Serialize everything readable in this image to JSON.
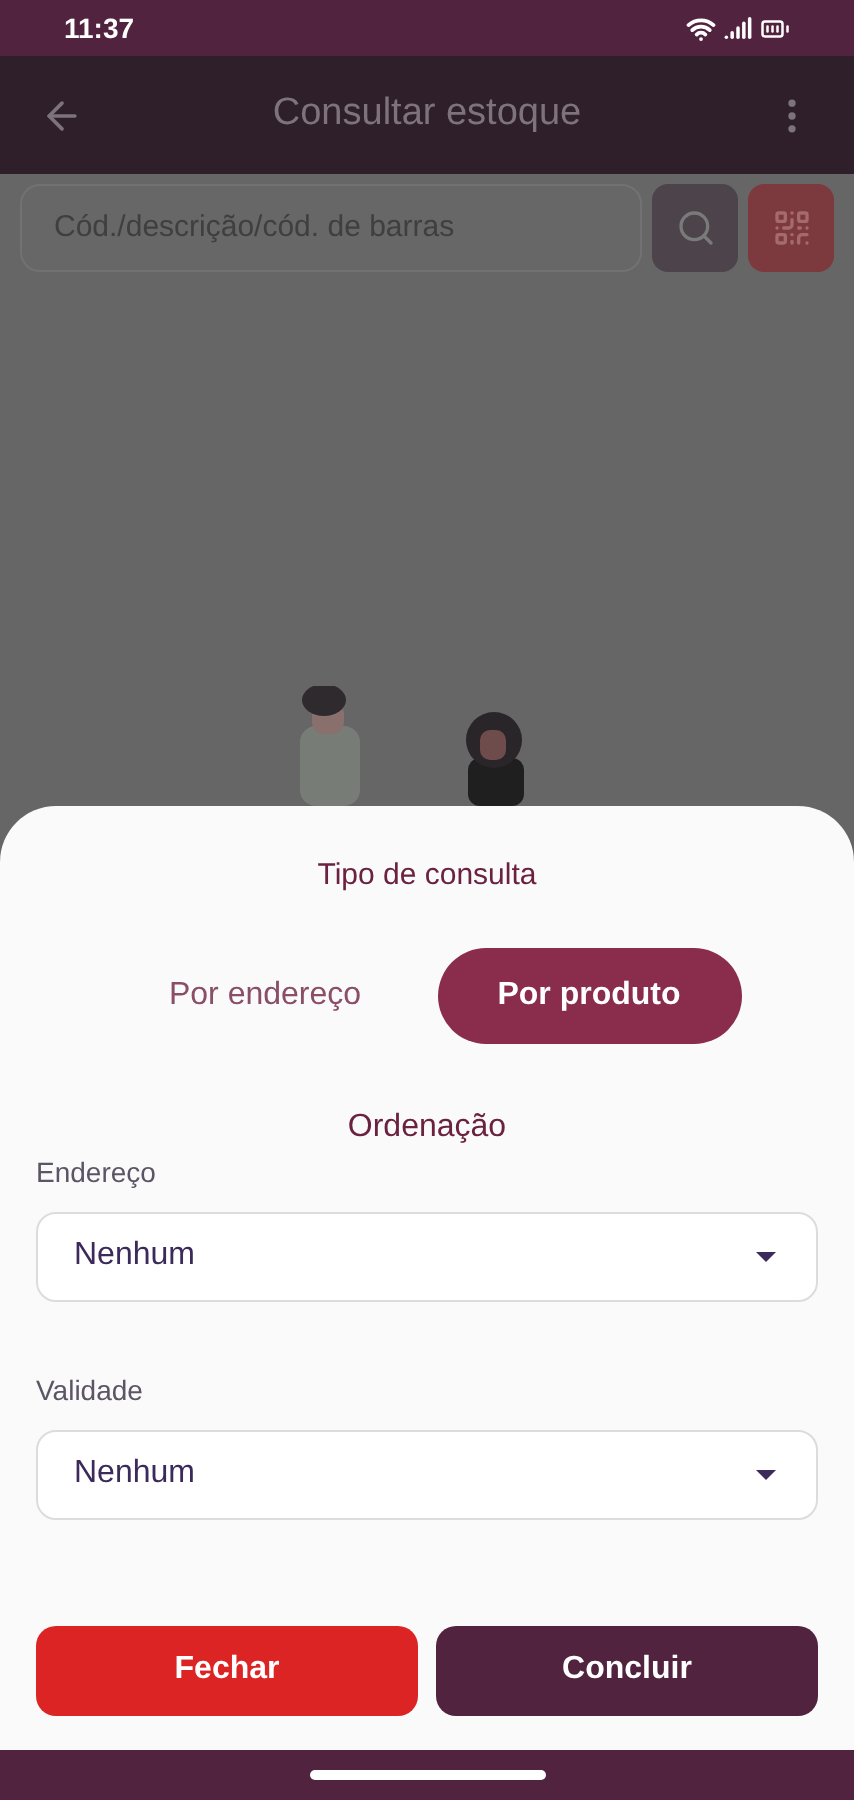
{
  "status_bar": {
    "time": "11:37"
  },
  "app_bar": {
    "title": "Consultar estoque"
  },
  "search": {
    "placeholder": "Cód./descrição/cód. de barras"
  },
  "sheet": {
    "title": "Tipo de consulta",
    "options": [
      {
        "label": "Por endereço",
        "selected": false
      },
      {
        "label": "Por produto",
        "selected": true
      }
    ],
    "section_title": "Ordenação",
    "fields": [
      {
        "label": "Endereço",
        "value": "Nenhum"
      },
      {
        "label": "Validade",
        "value": "Nenhum"
      }
    ],
    "buttons": [
      {
        "label": "Fechar",
        "kind": "cancel"
      },
      {
        "label": "Concluir",
        "kind": "confirm"
      }
    ]
  }
}
